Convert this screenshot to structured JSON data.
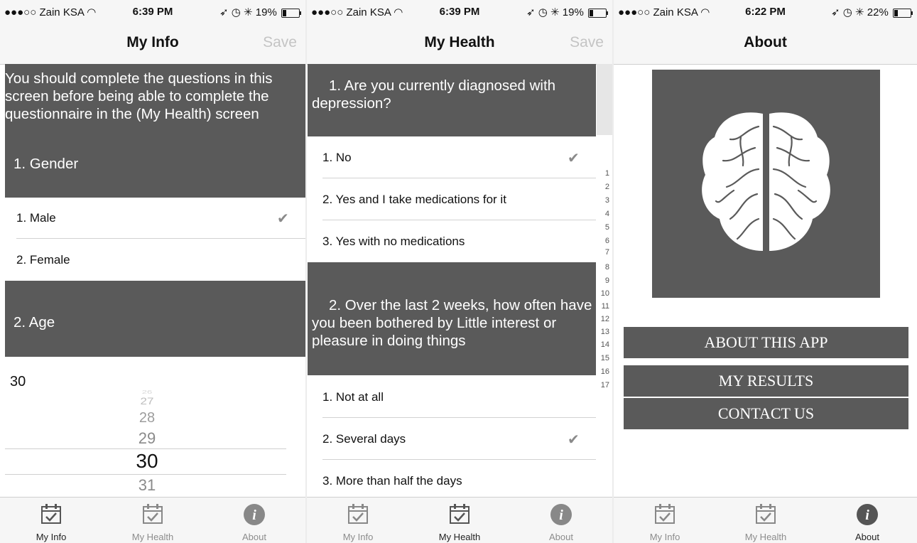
{
  "status_bars": [
    {
      "carrier": "●●●○○ Zain KSA",
      "time": "6:39 PM",
      "battery": "19%",
      "battery_level": 0.19
    },
    {
      "carrier": "●●●○○ Zain KSA",
      "time": "6:39 PM",
      "battery": "19%",
      "battery_level": 0.19
    },
    {
      "carrier": "●●●○○ Zain KSA",
      "time": "6:22 PM",
      "battery": "22%",
      "battery_level": 0.22
    }
  ],
  "my_info": {
    "title": "My Info",
    "save": "Save",
    "intro": "You should complete the questions in this screen before being able to complete the questionnaire in the (My Health) screen",
    "q1": "1. Gender",
    "q1_options": [
      "1. Male",
      "2. Female"
    ],
    "q1_selected": 0,
    "q2": "2. Age",
    "age_value": "30",
    "picker": [
      "26",
      "27",
      "28",
      "29",
      "30",
      "31"
    ]
  },
  "my_health": {
    "title": "My Health",
    "save": "Save",
    "q1": "1. Are you currently diagnosed with depression?",
    "q1_options": [
      "1. No",
      "2. Yes and I take medications for it",
      "3. Yes with no medications"
    ],
    "q2": "2. Over the last 2 weeks, how often have you been bothered by Little interest or pleasure in doing things",
    "q2_options": [
      "1. Not at all",
      "2. Several days",
      "3. More than half the days"
    ],
    "index": [
      "1",
      "2",
      "3",
      "4",
      "5",
      "6",
      "7",
      "8",
      "9",
      "10",
      "11",
      "12",
      "13",
      "14",
      "15",
      "16",
      "17"
    ]
  },
  "about": {
    "title": "About",
    "buttons": [
      "ABOUT THIS APP",
      "MY RESULTS",
      "CONTACT US"
    ]
  },
  "tabs": [
    "My Info",
    "My Health",
    "About"
  ],
  "icons": {
    "status": [
      "wifi-icon",
      "location-arrow-icon",
      "alarm-icon",
      "bluetooth-icon",
      "battery-icon"
    ],
    "tabs": [
      "calendar-check-icon",
      "calendar-check-icon",
      "info-icon"
    ],
    "check": "checkmark-icon",
    "brain": "brain-icon"
  },
  "colors": {
    "block": "#5a5a5a",
    "bar": "#f6f6f6",
    "save_disabled": "#c4c4c4"
  }
}
